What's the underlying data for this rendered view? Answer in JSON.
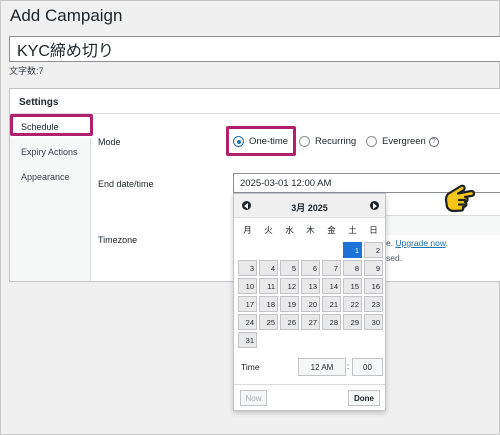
{
  "page": {
    "heading": "Add Campaign"
  },
  "title_field": {
    "value": "KYC締め切り",
    "char_count": "文字数:7"
  },
  "settings": {
    "header": "Settings",
    "nav": [
      {
        "label": "Schedule",
        "active": true
      },
      {
        "label": "Expiry Actions",
        "active": false
      },
      {
        "label": "Appearance",
        "active": false
      }
    ],
    "mode": {
      "label": "Mode",
      "options": [
        {
          "label": "One-time",
          "checked": true
        },
        {
          "label": "Recurring",
          "checked": false
        },
        {
          "label": "Evergreen",
          "checked": false,
          "help": "?"
        }
      ]
    },
    "end_date": {
      "label": "End date/time",
      "value": "2025-03-01 12:00 AM"
    },
    "timezone": {
      "label": "Timezone"
    },
    "partial_text": {
      "upgrade_prefix": "e.",
      "upgrade_link": "Upgrade now",
      "upgrade_suffix": ".",
      "line2": "sed."
    }
  },
  "calendar": {
    "month_title": "3月 2025",
    "weekdays": [
      "月",
      "火",
      "水",
      "木",
      "金",
      "土",
      "日"
    ],
    "leading_blanks": 5,
    "days": [
      "1",
      "2",
      "3",
      "4",
      "5",
      "6",
      "7",
      "8",
      "9",
      "10",
      "11",
      "12",
      "13",
      "14",
      "15",
      "16",
      "17",
      "18",
      "19",
      "20",
      "21",
      "22",
      "23",
      "24",
      "25",
      "26",
      "27",
      "28",
      "29",
      "30",
      "31"
    ],
    "selected_day": "1",
    "time_label": "Time",
    "hour_value": "12 AM",
    "time_separator": ":",
    "minute_value": "00",
    "now_label": "Now",
    "done_label": "Done"
  },
  "colors": {
    "highlight": "#b0206c",
    "selected_day": "#1e73d8",
    "accent": "#2271b1",
    "pointer_hand": "#f5c518"
  },
  "icons": {
    "prev": "chevron-left-icon",
    "next": "chevron-right-icon",
    "pointer": "pointing-hand-icon"
  }
}
